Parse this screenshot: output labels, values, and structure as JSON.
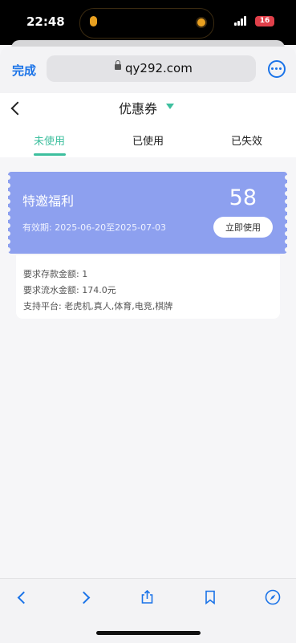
{
  "status_bar": {
    "time": "22:48",
    "battery": "16"
  },
  "browser": {
    "done_label": "完成",
    "url": "qy292.com"
  },
  "page": {
    "title": "优惠券",
    "tabs": [
      {
        "label": "未使用",
        "active": true
      },
      {
        "label": "已使用",
        "active": false
      },
      {
        "label": "已失效",
        "active": false
      }
    ]
  },
  "coupon": {
    "name": "特邀福利",
    "amount": "58",
    "validity": "有效期:  2025-06-20至2025-07-03",
    "use_button": "立即使用",
    "color": "#8da0ef"
  },
  "details": {
    "deposit": "要求存款金额:  1",
    "turnover": "要求流水金额:  174.0元",
    "platforms": "支持平台:  老虎机,真人,体育,电竞,棋牌"
  },
  "accent_color": "#3dbf9e",
  "link_color": "#1a73e8"
}
